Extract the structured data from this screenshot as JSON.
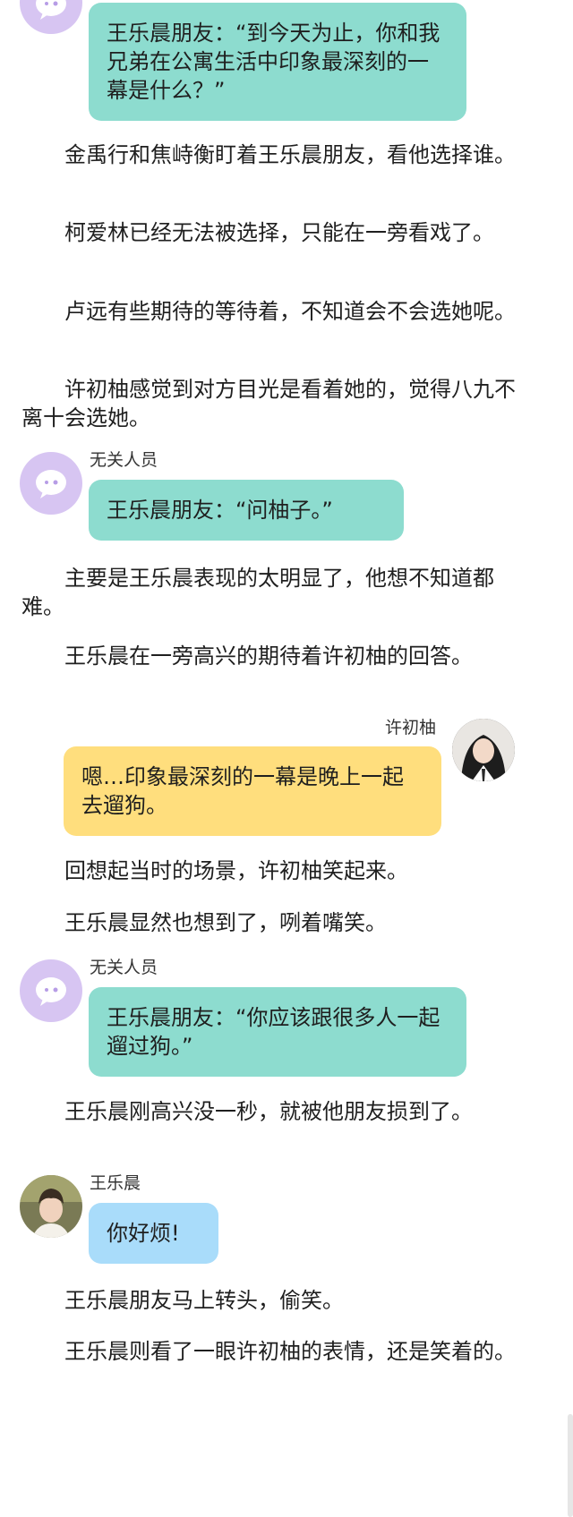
{
  "messages": {
    "m1": {
      "text": "王乐晨朋友：“到今天为止，你和我兄弟在公寓生活中印象最深刻的一幕是什么？”"
    },
    "m2": {
      "speaker": "无关人员",
      "text": "王乐晨朋友：“问柚子。”"
    },
    "m3": {
      "speaker": "许初柚",
      "text": "嗯…印象最深刻的一幕是晚上一起去遛狗。"
    },
    "m4": {
      "speaker": "无关人员",
      "text": "王乐晨朋友：“你应该跟很多人一起遛过狗。”"
    },
    "m5": {
      "speaker": "王乐晨",
      "text": "你好烦!"
    }
  },
  "paragraphs": [
    "金禹行和焦峙衡盯着王乐晨朋友，看他选择谁。",
    "柯爱林已经无法被选择，只能在一旁看戏了。",
    "卢远有些期待的等待着，不知道会不会选她呢。",
    "许初柚感觉到对方目光是看着她的，觉得八九不离十会选她。",
    "主要是王乐晨表现的太明显了，他想不知道都难。",
    "王乐晨在一旁高兴的期待着许初柚的回答。",
    "回想起当时的场景，许初柚笑起来。",
    "王乐晨显然也想到了，咧着嘴笑。",
    "王乐晨刚高兴没一秒，就被他朋友损到了。",
    "王乐晨朋友马上转头，偷笑。",
    "王乐晨则看了一眼许初柚的表情，还是笑着的。"
  ],
  "colors": {
    "teal_bubble": "#8ddccf",
    "yellow_bubble": "#ffde7d",
    "blue_bubble": "#a9dcfa",
    "ghost_avatar": "#d7c5f2"
  },
  "icons": {
    "ghost_avatar": "ghost-avatar-icon"
  }
}
